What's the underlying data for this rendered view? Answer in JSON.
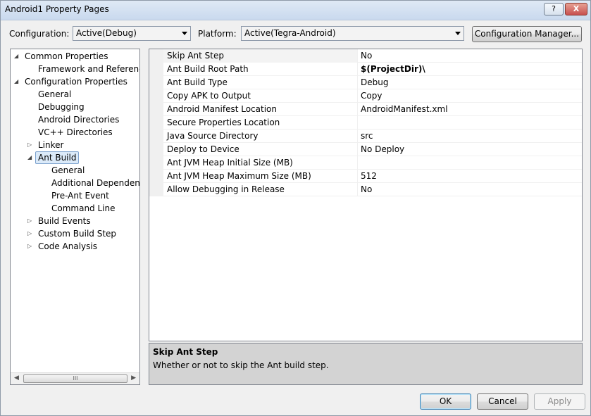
{
  "window": {
    "title": "Android1 Property Pages",
    "help_label": "?",
    "close_label": "X"
  },
  "toolbar": {
    "configuration_label": "Configuration:",
    "configuration_value": "Active(Debug)",
    "platform_label": "Platform:",
    "platform_value": "Active(Tegra-Android)",
    "config_manager_label": "Configuration Manager..."
  },
  "tree": {
    "items": [
      {
        "label": "Common Properties",
        "expander": "expanded"
      },
      {
        "label": "Framework and References",
        "expander": "none"
      },
      {
        "label": "Configuration Properties",
        "expander": "expanded"
      },
      {
        "label": "General",
        "expander": "none"
      },
      {
        "label": "Debugging",
        "expander": "none"
      },
      {
        "label": "Android Directories",
        "expander": "none"
      },
      {
        "label": "VC++ Directories",
        "expander": "none"
      },
      {
        "label": "Linker",
        "expander": "collapsed"
      },
      {
        "label": "Ant Build",
        "expander": "expanded",
        "selected": true
      },
      {
        "label": "General",
        "expander": "none"
      },
      {
        "label": "Additional Dependencies",
        "expander": "none"
      },
      {
        "label": "Pre-Ant Event",
        "expander": "none"
      },
      {
        "label": "Command Line",
        "expander": "none"
      },
      {
        "label": "Build Events",
        "expander": "collapsed"
      },
      {
        "label": "Custom Build Step",
        "expander": "collapsed"
      },
      {
        "label": "Code Analysis",
        "expander": "collapsed"
      }
    ],
    "scroll_grip": "III"
  },
  "properties": [
    {
      "name": "Skip Ant Step",
      "value": "No",
      "bold": false
    },
    {
      "name": "Ant Build Root Path",
      "value": "$(ProjectDir)\\",
      "bold": true
    },
    {
      "name": "Ant Build Type",
      "value": "Debug",
      "bold": false
    },
    {
      "name": "Copy APK to Output",
      "value": "Copy",
      "bold": false
    },
    {
      "name": "Android Manifest Location",
      "value": "AndroidManifest.xml",
      "bold": false
    },
    {
      "name": "Secure Properties Location",
      "value": "",
      "bold": false
    },
    {
      "name": "Java Source Directory",
      "value": "src",
      "bold": false
    },
    {
      "name": "Deploy to Device",
      "value": "No Deploy",
      "bold": false
    },
    {
      "name": "Ant JVM Heap Initial Size (MB)",
      "value": "",
      "bold": false
    },
    {
      "name": "Ant JVM Heap Maximum Size (MB)",
      "value": "512",
      "bold": false
    },
    {
      "name": "Allow Debugging in Release",
      "value": "No",
      "bold": false
    }
  ],
  "description": {
    "title": "Skip Ant Step",
    "text": "Whether or not to skip the Ant build step."
  },
  "buttons": {
    "ok": "OK",
    "cancel": "Cancel",
    "apply": "Apply"
  }
}
